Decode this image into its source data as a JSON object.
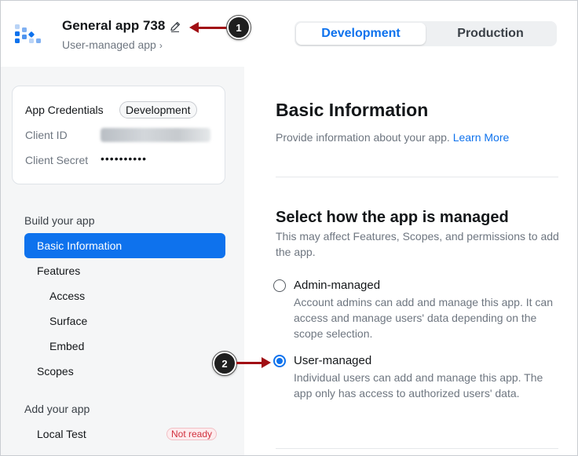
{
  "header": {
    "app_name": "General app 738",
    "app_type": "User-managed app",
    "chevron": "›",
    "environments": [
      {
        "label": "Development",
        "active": true
      },
      {
        "label": "Production",
        "active": false
      }
    ]
  },
  "callouts": {
    "one": "1",
    "two": "2"
  },
  "credentials": {
    "title": "App Credentials",
    "badge": "Development",
    "client_id_label": "Client ID",
    "client_secret_label": "Client Secret",
    "client_secret_value": "••••••••••"
  },
  "sidebar": {
    "section_build": "Build your app",
    "items": [
      {
        "label": "Basic Information",
        "active": true
      },
      {
        "label": "Features"
      },
      {
        "label": "Access"
      },
      {
        "label": "Surface"
      },
      {
        "label": "Embed"
      },
      {
        "label": "Scopes"
      }
    ],
    "section_add": "Add your app",
    "local_test": "Local Test",
    "local_test_status": "Not ready"
  },
  "main": {
    "title": "Basic Information",
    "description": "Provide information about your app.",
    "learn_more": "Learn More",
    "section_title": "Select how the app is managed",
    "section_desc": "This may affect Features, Scopes, and permissions to add the app.",
    "options": [
      {
        "label": "Admin-managed",
        "desc": "Account admins can add and manage this app. It can access and manage users' data depending on the scope selection.",
        "checked": false
      },
      {
        "label": "User-managed",
        "desc": "Individual users can add and manage this app. The app only has access to authorized users' data.",
        "checked": true
      }
    ]
  },
  "colors": {
    "accent": "#0e72ed",
    "callout_arrow": "#a10f14",
    "badge_danger": "#d1303d"
  }
}
